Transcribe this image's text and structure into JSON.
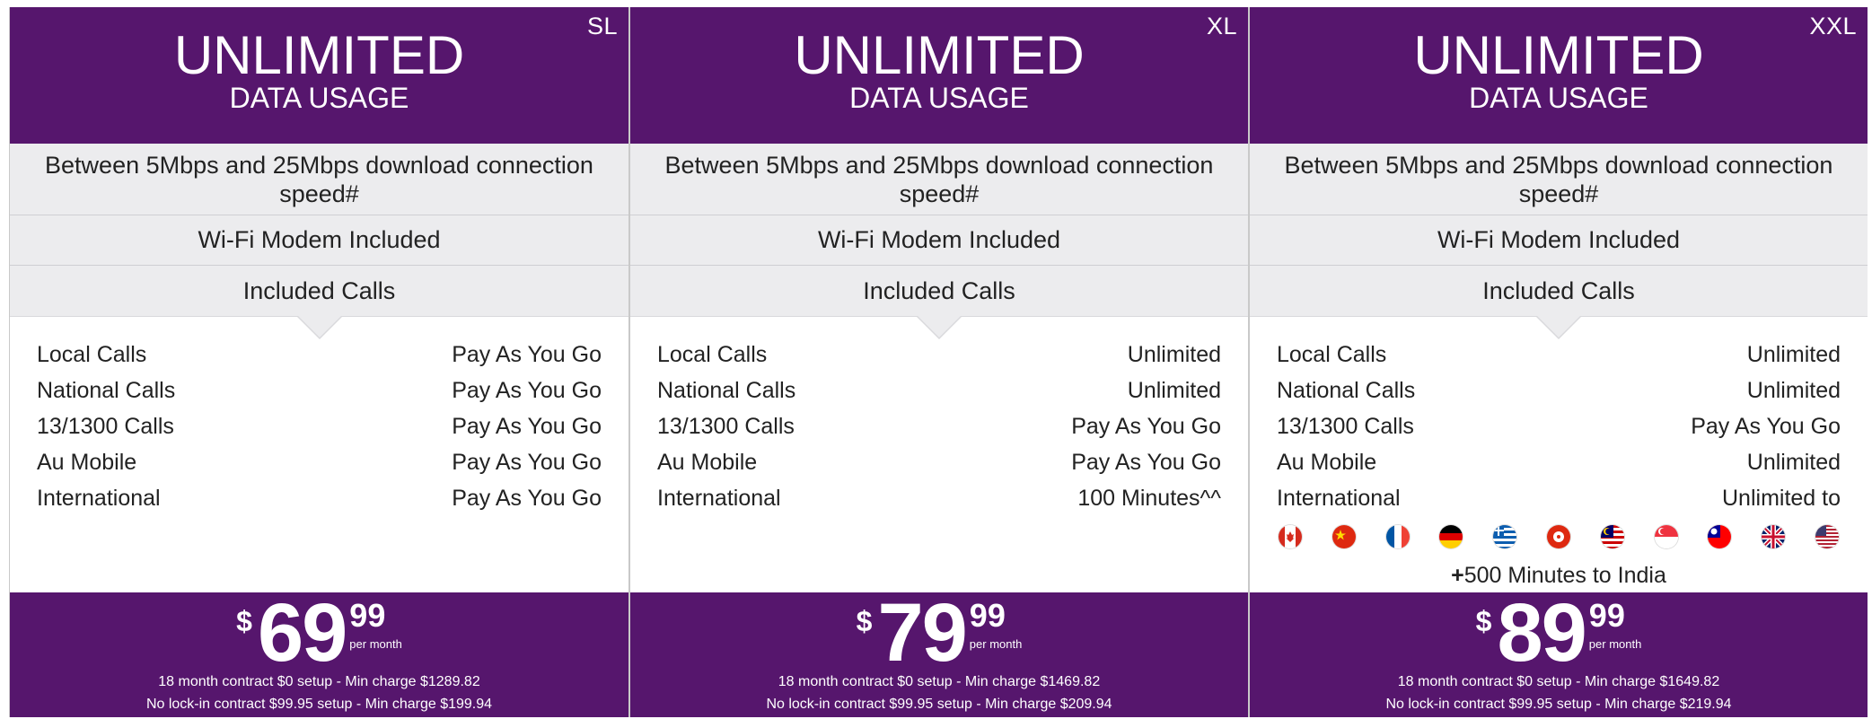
{
  "plans": [
    {
      "tier": "SL",
      "headline": "UNLIMITED",
      "subline": "DATA USAGE",
      "speed": "Between 5Mbps and 25Mbps download connection speed#",
      "wifi": "Wi-Fi Modem Included",
      "calls_header": "Included Calls",
      "calls": [
        {
          "label": "Local Calls",
          "value": "Pay As You Go"
        },
        {
          "label": "National Calls",
          "value": "Pay As You Go"
        },
        {
          "label": "13/1300 Calls",
          "value": "Pay As You Go"
        },
        {
          "label": "Au Mobile",
          "value": "Pay As You Go"
        },
        {
          "label": "International",
          "value": "Pay As You Go"
        }
      ],
      "price": {
        "currency": "$",
        "dollars": "69",
        "cents": "99",
        "per": "per month"
      },
      "terms": [
        "18 month contract $0 setup - Min charge $1289.82",
        "No lock-in contract $99.95 setup - Min charge $199.94"
      ]
    },
    {
      "tier": "XL",
      "headline": "UNLIMITED",
      "subline": "DATA USAGE",
      "speed": "Between 5Mbps and 25Mbps download connection speed#",
      "wifi": "Wi-Fi Modem Included",
      "calls_header": "Included Calls",
      "calls": [
        {
          "label": "Local Calls",
          "value": "Unlimited"
        },
        {
          "label": "National Calls",
          "value": "Unlimited"
        },
        {
          "label": "13/1300 Calls",
          "value": "Pay As You Go"
        },
        {
          "label": "Au Mobile",
          "value": "Pay As You Go"
        },
        {
          "label": "International",
          "value": "100 Minutes^^"
        }
      ],
      "price": {
        "currency": "$",
        "dollars": "79",
        "cents": "99",
        "per": "per month"
      },
      "terms": [
        "18 month contract $0 setup - Min charge $1469.82",
        "No lock-in contract $99.95 setup - Min charge $209.94"
      ]
    },
    {
      "tier": "XXL",
      "headline": "UNLIMITED",
      "subline": "DATA USAGE",
      "speed": "Between 5Mbps and 25Mbps download connection speed#",
      "wifi": "Wi-Fi Modem Included",
      "calls_header": "Included Calls",
      "calls": [
        {
          "label": "Local Calls",
          "value": "Unlimited"
        },
        {
          "label": "National Calls",
          "value": "Unlimited"
        },
        {
          "label": "13/1300 Calls",
          "value": "Pay As You Go"
        },
        {
          "label": "Au Mobile",
          "value": "Unlimited"
        },
        {
          "label": "International",
          "value": "Unlimited to"
        }
      ],
      "flags": [
        "canada-flag-icon",
        "china-flag-icon",
        "france-flag-icon",
        "germany-flag-icon",
        "greece-flag-icon",
        "hong-kong-flag-icon",
        "malaysia-flag-icon",
        "singapore-flag-icon",
        "taiwan-flag-icon",
        "uk-flag-icon",
        "usa-flag-icon"
      ],
      "india_plus": "+",
      "india_note": "500 Minutes to India",
      "price": {
        "currency": "$",
        "dollars": "89",
        "cents": "99",
        "per": "per month"
      },
      "terms": [
        "18 month contract $0 setup - Min charge $1649.82",
        "No lock-in contract $99.95 setup - Min charge $219.94"
      ]
    }
  ],
  "colors": {
    "brand_purple": "#56166d",
    "feature_grey": "#ececee"
  }
}
